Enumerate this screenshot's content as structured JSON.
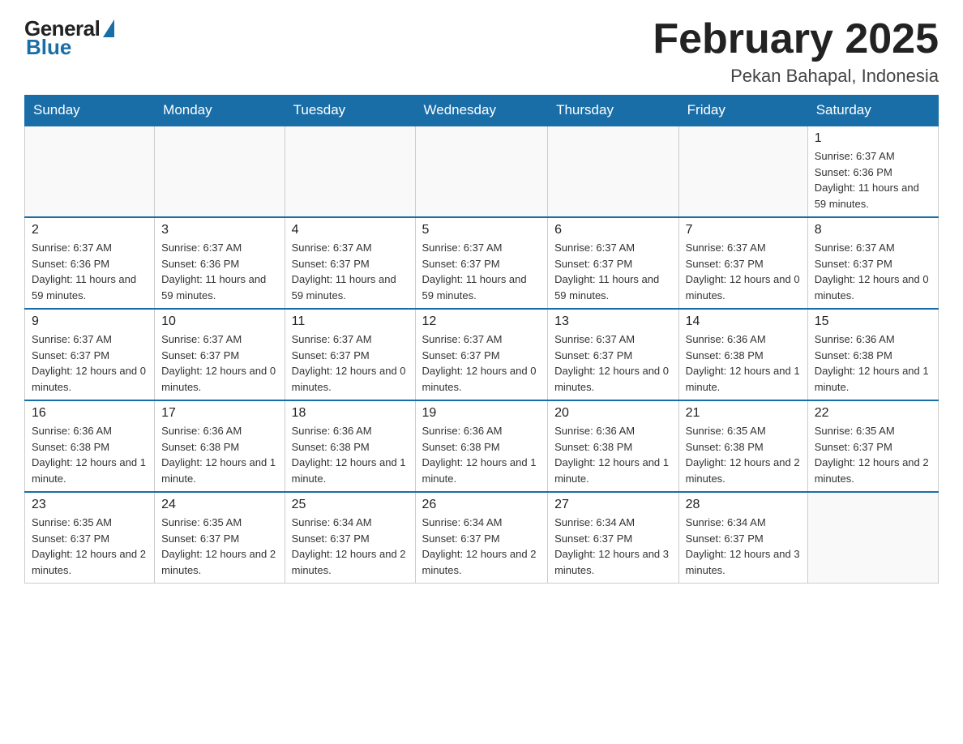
{
  "header": {
    "logo": {
      "general": "General",
      "blue": "Blue"
    },
    "title": "February 2025",
    "location": "Pekan Bahapal, Indonesia"
  },
  "days_of_week": [
    "Sunday",
    "Monday",
    "Tuesday",
    "Wednesday",
    "Thursday",
    "Friday",
    "Saturday"
  ],
  "weeks": [
    [
      {
        "day": "",
        "info": ""
      },
      {
        "day": "",
        "info": ""
      },
      {
        "day": "",
        "info": ""
      },
      {
        "day": "",
        "info": ""
      },
      {
        "day": "",
        "info": ""
      },
      {
        "day": "",
        "info": ""
      },
      {
        "day": "1",
        "info": "Sunrise: 6:37 AM\nSunset: 6:36 PM\nDaylight: 11 hours and 59 minutes."
      }
    ],
    [
      {
        "day": "2",
        "info": "Sunrise: 6:37 AM\nSunset: 6:36 PM\nDaylight: 11 hours and 59 minutes."
      },
      {
        "day": "3",
        "info": "Sunrise: 6:37 AM\nSunset: 6:36 PM\nDaylight: 11 hours and 59 minutes."
      },
      {
        "day": "4",
        "info": "Sunrise: 6:37 AM\nSunset: 6:37 PM\nDaylight: 11 hours and 59 minutes."
      },
      {
        "day": "5",
        "info": "Sunrise: 6:37 AM\nSunset: 6:37 PM\nDaylight: 11 hours and 59 minutes."
      },
      {
        "day": "6",
        "info": "Sunrise: 6:37 AM\nSunset: 6:37 PM\nDaylight: 11 hours and 59 minutes."
      },
      {
        "day": "7",
        "info": "Sunrise: 6:37 AM\nSunset: 6:37 PM\nDaylight: 12 hours and 0 minutes."
      },
      {
        "day": "8",
        "info": "Sunrise: 6:37 AM\nSunset: 6:37 PM\nDaylight: 12 hours and 0 minutes."
      }
    ],
    [
      {
        "day": "9",
        "info": "Sunrise: 6:37 AM\nSunset: 6:37 PM\nDaylight: 12 hours and 0 minutes."
      },
      {
        "day": "10",
        "info": "Sunrise: 6:37 AM\nSunset: 6:37 PM\nDaylight: 12 hours and 0 minutes."
      },
      {
        "day": "11",
        "info": "Sunrise: 6:37 AM\nSunset: 6:37 PM\nDaylight: 12 hours and 0 minutes."
      },
      {
        "day": "12",
        "info": "Sunrise: 6:37 AM\nSunset: 6:37 PM\nDaylight: 12 hours and 0 minutes."
      },
      {
        "day": "13",
        "info": "Sunrise: 6:37 AM\nSunset: 6:37 PM\nDaylight: 12 hours and 0 minutes."
      },
      {
        "day": "14",
        "info": "Sunrise: 6:36 AM\nSunset: 6:38 PM\nDaylight: 12 hours and 1 minute."
      },
      {
        "day": "15",
        "info": "Sunrise: 6:36 AM\nSunset: 6:38 PM\nDaylight: 12 hours and 1 minute."
      }
    ],
    [
      {
        "day": "16",
        "info": "Sunrise: 6:36 AM\nSunset: 6:38 PM\nDaylight: 12 hours and 1 minute."
      },
      {
        "day": "17",
        "info": "Sunrise: 6:36 AM\nSunset: 6:38 PM\nDaylight: 12 hours and 1 minute."
      },
      {
        "day": "18",
        "info": "Sunrise: 6:36 AM\nSunset: 6:38 PM\nDaylight: 12 hours and 1 minute."
      },
      {
        "day": "19",
        "info": "Sunrise: 6:36 AM\nSunset: 6:38 PM\nDaylight: 12 hours and 1 minute."
      },
      {
        "day": "20",
        "info": "Sunrise: 6:36 AM\nSunset: 6:38 PM\nDaylight: 12 hours and 1 minute."
      },
      {
        "day": "21",
        "info": "Sunrise: 6:35 AM\nSunset: 6:38 PM\nDaylight: 12 hours and 2 minutes."
      },
      {
        "day": "22",
        "info": "Sunrise: 6:35 AM\nSunset: 6:37 PM\nDaylight: 12 hours and 2 minutes."
      }
    ],
    [
      {
        "day": "23",
        "info": "Sunrise: 6:35 AM\nSunset: 6:37 PM\nDaylight: 12 hours and 2 minutes."
      },
      {
        "day": "24",
        "info": "Sunrise: 6:35 AM\nSunset: 6:37 PM\nDaylight: 12 hours and 2 minutes."
      },
      {
        "day": "25",
        "info": "Sunrise: 6:34 AM\nSunset: 6:37 PM\nDaylight: 12 hours and 2 minutes."
      },
      {
        "day": "26",
        "info": "Sunrise: 6:34 AM\nSunset: 6:37 PM\nDaylight: 12 hours and 2 minutes."
      },
      {
        "day": "27",
        "info": "Sunrise: 6:34 AM\nSunset: 6:37 PM\nDaylight: 12 hours and 3 minutes."
      },
      {
        "day": "28",
        "info": "Sunrise: 6:34 AM\nSunset: 6:37 PM\nDaylight: 12 hours and 3 minutes."
      },
      {
        "day": "",
        "info": ""
      }
    ]
  ]
}
